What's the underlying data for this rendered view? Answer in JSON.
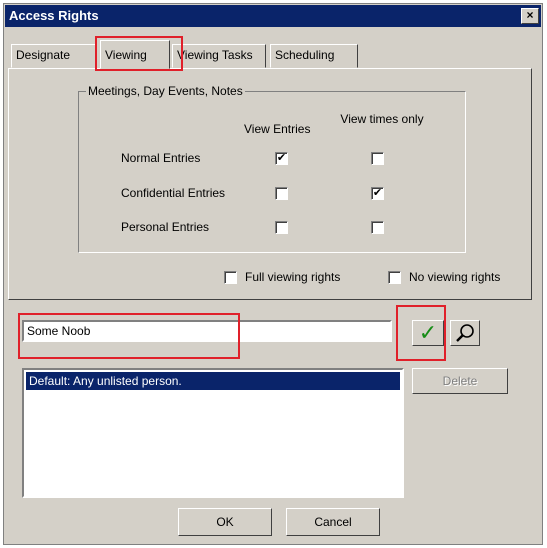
{
  "dialog": {
    "title": "Access Rights",
    "close_glyph": "×"
  },
  "tabs": [
    {
      "label": "Designate",
      "active": false
    },
    {
      "label": "Viewing",
      "active": true
    },
    {
      "label": "Viewing Tasks",
      "active": false
    },
    {
      "label": "Scheduling",
      "active": false
    }
  ],
  "group": {
    "title": "Meetings, Day Events, Notes",
    "col_view_entries": "View Entries",
    "col_view_times": "View times only",
    "rows": [
      {
        "label": "Normal Entries",
        "view_entries": true,
        "view_times_only": false
      },
      {
        "label": "Confidential Entries",
        "view_entries": false,
        "view_times_only": true
      },
      {
        "label": "Personal Entries",
        "view_entries": false,
        "view_times_only": false
      }
    ]
  },
  "options": {
    "full_viewing_rights": "Full viewing rights",
    "no_viewing_rights": "No viewing rights"
  },
  "name_input": {
    "value": "Some Noob"
  },
  "icons": {
    "apply": "checkmark-icon",
    "find": "magnifier-icon"
  },
  "list": {
    "items": [
      "Default: Any unlisted person."
    ]
  },
  "buttons": {
    "delete": "Delete",
    "ok": "OK",
    "cancel": "Cancel"
  },
  "colors": {
    "titlebar": "#0a246a",
    "face": "#d4d0c8",
    "highlight_box": "#e0202a",
    "selection": "#0a246a",
    "check_green": "#168c16"
  }
}
